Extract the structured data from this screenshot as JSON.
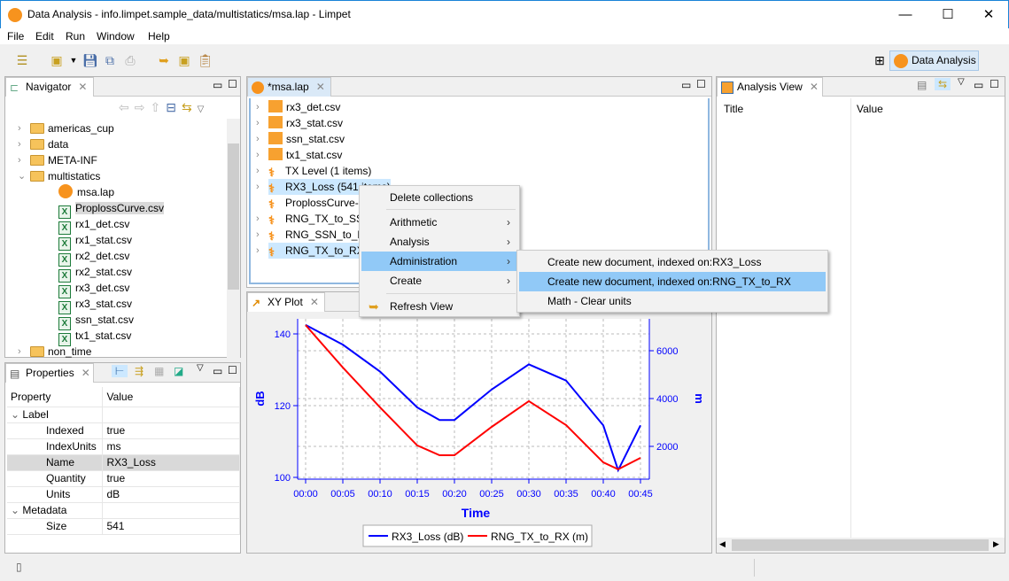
{
  "window": {
    "title": "Data Analysis - info.limpet.sample_data/multistatics/msa.lap - Limpet",
    "minimize": "—",
    "maximize": "☐",
    "close": "✕"
  },
  "menu": [
    "File",
    "Edit",
    "Run",
    "Window",
    "Help"
  ],
  "perspective": {
    "label": "Data Analysis"
  },
  "navigator": {
    "title": "Navigator",
    "items": [
      {
        "label": "americas_cup",
        "type": "folder",
        "expanded": false,
        "depth": 0
      },
      {
        "label": "data",
        "type": "folder",
        "expanded": false,
        "depth": 0
      },
      {
        "label": "META-INF",
        "type": "folder",
        "expanded": false,
        "depth": 0
      },
      {
        "label": "multistatics",
        "type": "folder",
        "expanded": true,
        "depth": 0
      },
      {
        "label": "msa.lap",
        "type": "lap",
        "depth": 1
      },
      {
        "label": "ProplossCurve.csv",
        "type": "csv",
        "depth": 1,
        "selected": true
      },
      {
        "label": "rx1_det.csv",
        "type": "csv",
        "depth": 1
      },
      {
        "label": "rx1_stat.csv",
        "type": "csv",
        "depth": 1
      },
      {
        "label": "rx2_det.csv",
        "type": "csv",
        "depth": 1
      },
      {
        "label": "rx2_stat.csv",
        "type": "csv",
        "depth": 1
      },
      {
        "label": "rx3_det.csv",
        "type": "csv",
        "depth": 1
      },
      {
        "label": "rx3_stat.csv",
        "type": "csv",
        "depth": 1
      },
      {
        "label": "ssn_stat.csv",
        "type": "csv",
        "depth": 1
      },
      {
        "label": "tx1_stat.csv",
        "type": "csv",
        "depth": 1
      },
      {
        "label": "non_time",
        "type": "folder",
        "expanded": false,
        "depth": 0
      }
    ]
  },
  "properties": {
    "title": "Properties",
    "headers": [
      "Property",
      "Value"
    ],
    "rows": [
      {
        "name": "Label",
        "value": "",
        "group": true
      },
      {
        "name": "Indexed",
        "value": "true"
      },
      {
        "name": "IndexUnits",
        "value": "ms"
      },
      {
        "name": "Name",
        "value": "RX3_Loss",
        "selected": true
      },
      {
        "name": "Quantity",
        "value": "true"
      },
      {
        "name": "Units",
        "value": "dB"
      },
      {
        "name": "Metadata",
        "value": "",
        "group": true
      },
      {
        "name": "Size",
        "value": "541"
      }
    ]
  },
  "editor": {
    "title": "*msa.lap",
    "items": [
      {
        "label": "rx3_det.csv",
        "type": "group"
      },
      {
        "label": "rx3_stat.csv",
        "type": "group"
      },
      {
        "label": "ssn_stat.csv",
        "type": "group"
      },
      {
        "label": "tx1_stat.csv",
        "type": "group"
      },
      {
        "label": "TX Level (1 items)",
        "type": "coll"
      },
      {
        "label": "RX3_Loss (541 items)",
        "type": "coll",
        "selected": true
      },
      {
        "label": "ProplossCurve-",
        "type": "coll",
        "nochev": true
      },
      {
        "label": "RNG_TX_to_SSN",
        "type": "coll"
      },
      {
        "label": "RNG_SSN_to_RX",
        "type": "coll"
      },
      {
        "label": "RNG_TX_to_RX",
        "type": "coll",
        "selected": true
      }
    ]
  },
  "context_menu": {
    "items": [
      {
        "label": "Delete collections"
      },
      {
        "label": "Arithmetic",
        "sub": true
      },
      {
        "label": "Analysis",
        "sub": true
      },
      {
        "label": "Administration",
        "sub": true,
        "highlight": true
      },
      {
        "label": "Create",
        "sub": true
      },
      {
        "label": "Refresh View",
        "icon": "refresh-icon"
      }
    ],
    "submenu": [
      {
        "label": "Create new document, indexed on:RX3_Loss"
      },
      {
        "label": "Create new document, indexed on:RNG_TX_to_RX",
        "highlight": true
      },
      {
        "label": "Math - Clear units"
      }
    ]
  },
  "analysis_view": {
    "title": "Analysis View",
    "headers": [
      "Title",
      "Value"
    ]
  },
  "xyplot": {
    "title": "XY Plot"
  },
  "chart_data": {
    "type": "line",
    "xlabel": "Time",
    "ylabel": "dB",
    "y2label": "m",
    "x_ticks": [
      "00:00",
      "00:05",
      "00:10",
      "00:15",
      "00:20",
      "00:25",
      "00:30",
      "00:35",
      "00:40",
      "00:45"
    ],
    "xlim_minutes": [
      0,
      45
    ],
    "ylim": [
      100,
      140
    ],
    "y_ticks": [
      100,
      120,
      140
    ],
    "y2_ticks": [
      2000,
      4000,
      6000
    ],
    "grid": true,
    "legend": "bottom",
    "series": [
      {
        "name": "RX3_Loss (dB)",
        "axis": "left",
        "color": "#0000ff",
        "x": [
          0,
          5,
          10,
          15,
          18,
          20,
          25,
          30,
          35,
          40,
          42,
          45
        ],
        "values": [
          142.5,
          137,
          129.5,
          119.5,
          116,
          116,
          124.5,
          131.5,
          127,
          114.5,
          102,
          114.5
        ]
      },
      {
        "name": "RNG_TX_to_RX (m)",
        "axis": "right",
        "color": "#ff0000",
        "x": [
          0,
          5,
          10,
          15,
          18,
          20,
          25,
          30,
          35,
          40,
          42,
          45
        ],
        "values": [
          7070,
          5300,
          3630,
          2040,
          1630,
          1630,
          2815,
          3890,
          2890,
          1330,
          1040,
          1520
        ]
      }
    ]
  }
}
